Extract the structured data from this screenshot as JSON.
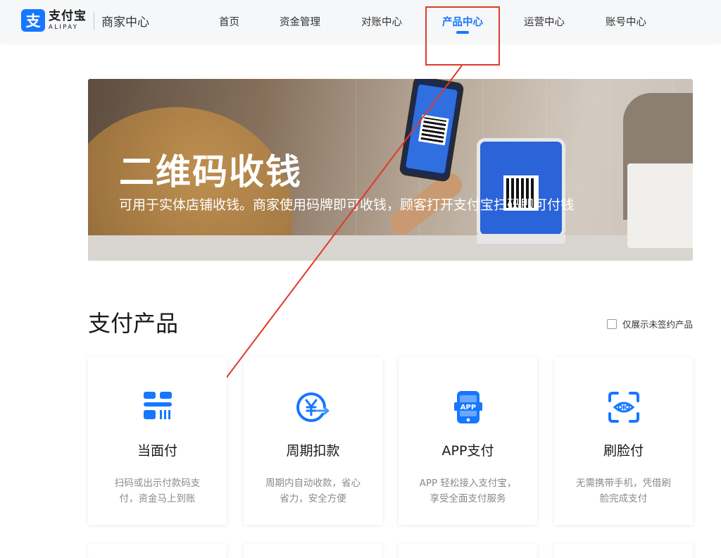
{
  "header": {
    "logo_cn": "支付宝",
    "logo_en": "ALIPAY",
    "logo_glyph": "支",
    "subtitle": "商家中心",
    "nav": [
      "首页",
      "资金管理",
      "对账中心",
      "产品中心",
      "运营中心",
      "账号中心"
    ],
    "active_nav": "产品中心"
  },
  "banner": {
    "title": "二维码收钱",
    "description": "可用于实体店铺收钱。商家使用码牌即可收钱，顾客打开支付宝扫码即可付钱"
  },
  "section": {
    "title": "支付产品",
    "filter_label": "仅展示未签约产品",
    "filter_checked": false
  },
  "products": [
    {
      "title": "当面付",
      "description": "扫码或出示付款码支付，资金马上到账",
      "icon": "barcode-scan-icon"
    },
    {
      "title": "周期扣款",
      "description": "周期内自动收款，省心省力，安全方便",
      "icon": "yuan-cycle-icon"
    },
    {
      "title": "APP支付",
      "description": "APP 轻松接入支付宝，享受全面支付服务",
      "icon": "app-phone-icon"
    },
    {
      "title": "刷脸付",
      "description": "无需携带手机，凭借刷脸完成支付",
      "icon": "face-scan-icon"
    }
  ],
  "colors": {
    "accent": "#1677ff",
    "annotation": "#e0392b"
  }
}
